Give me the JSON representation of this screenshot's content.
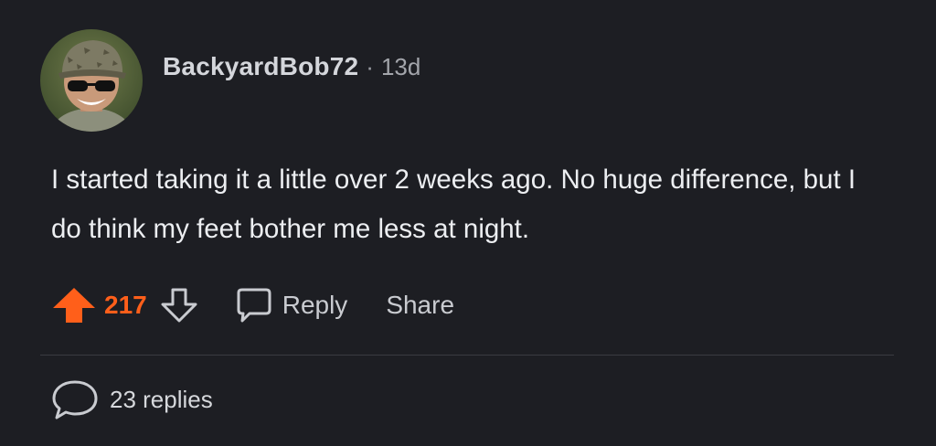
{
  "comment": {
    "username": "BackyardBob72",
    "separator": "·",
    "age": "13d",
    "body": "I started taking it a little over 2 weeks ago. No huge difference, but I do think my feet bother me less at night.",
    "score": "217",
    "reply_label": "Reply",
    "share_label": "Share",
    "replies_label": "23 replies"
  },
  "colors": {
    "background": "#1d1e23",
    "upvote_accent": "#ff5f1a",
    "text": "#eceef1",
    "muted": "#a3a5ab"
  },
  "icons": {
    "upvote": "upvote-arrow-icon",
    "downvote": "downvote-arrow-icon",
    "reply": "speech-bubble-icon",
    "replies": "speech-bubble-icon"
  }
}
